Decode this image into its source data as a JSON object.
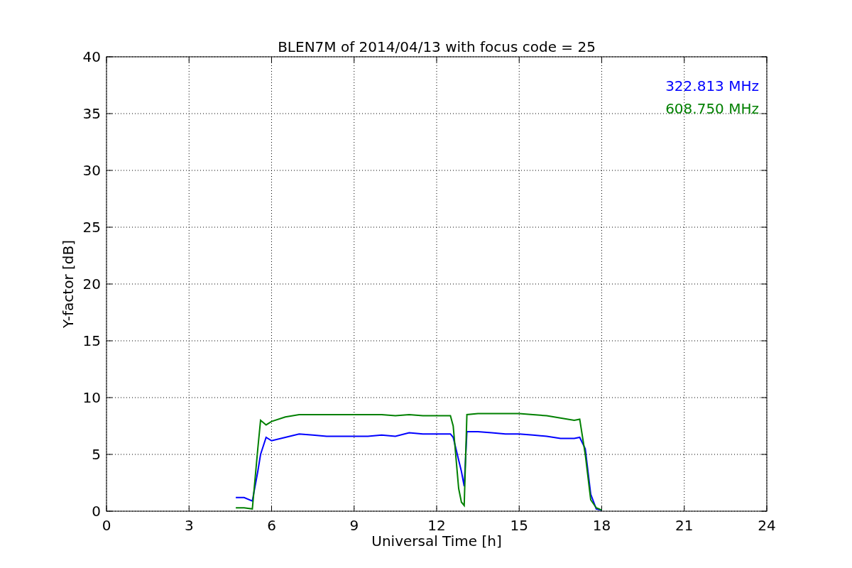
{
  "chart_data": {
    "type": "line",
    "title": "BLEN7M of 2014/04/13 with focus code = 25",
    "xlabel": "Universal Time [h]",
    "ylabel": "Y-factor [dB]",
    "x": [
      4.7,
      5.0,
      5.3,
      5.5,
      5.6,
      5.8,
      6.0,
      6.5,
      7,
      7.5,
      8,
      8.5,
      9,
      9.5,
      10,
      10.5,
      11,
      11.5,
      12,
      12.5,
      12.6,
      12.8,
      12.9,
      13.0,
      13.1,
      13.5,
      14,
      14.5,
      15,
      15.5,
      16,
      16.5,
      17,
      17.2,
      17.4,
      17.6,
      17.8,
      18.0
    ],
    "series": [
      {
        "name": "322.813 MHz",
        "color": "#0000ff",
        "values": [
          1.2,
          1.2,
          0.9,
          3.5,
          5,
          6.5,
          6.2,
          6.5,
          6.8,
          6.7,
          6.6,
          6.6,
          6.6,
          6.6,
          6.7,
          6.6,
          6.9,
          6.8,
          6.8,
          6.8,
          6.5,
          4.5,
          3.5,
          2.2,
          7.0,
          7.0,
          6.9,
          6.8,
          6.8,
          6.7,
          6.6,
          6.4,
          6.4,
          6.5,
          5.5,
          1.5,
          0.2,
          0.1
        ]
      },
      {
        "name": "608.750 MHz",
        "color": "#008000",
        "values": [
          0.3,
          0.3,
          0.2,
          5.5,
          8.0,
          7.6,
          7.9,
          8.3,
          8.5,
          8.5,
          8.5,
          8.5,
          8.5,
          8.5,
          8.5,
          8.4,
          8.5,
          8.4,
          8.4,
          8.4,
          7.5,
          2.0,
          0.8,
          0.5,
          8.5,
          8.6,
          8.6,
          8.6,
          8.6,
          8.5,
          8.4,
          8.2,
          8.0,
          8.1,
          5.0,
          1.0,
          0.3,
          0.1
        ]
      }
    ],
    "grid": true,
    "xlim": [
      0,
      24
    ],
    "ylim": [
      0,
      40
    ],
    "xticks": [
      0,
      3,
      6,
      9,
      12,
      15,
      18,
      21,
      24
    ],
    "yticks": [
      0,
      5,
      10,
      15,
      20,
      25,
      30,
      35,
      40
    ]
  }
}
